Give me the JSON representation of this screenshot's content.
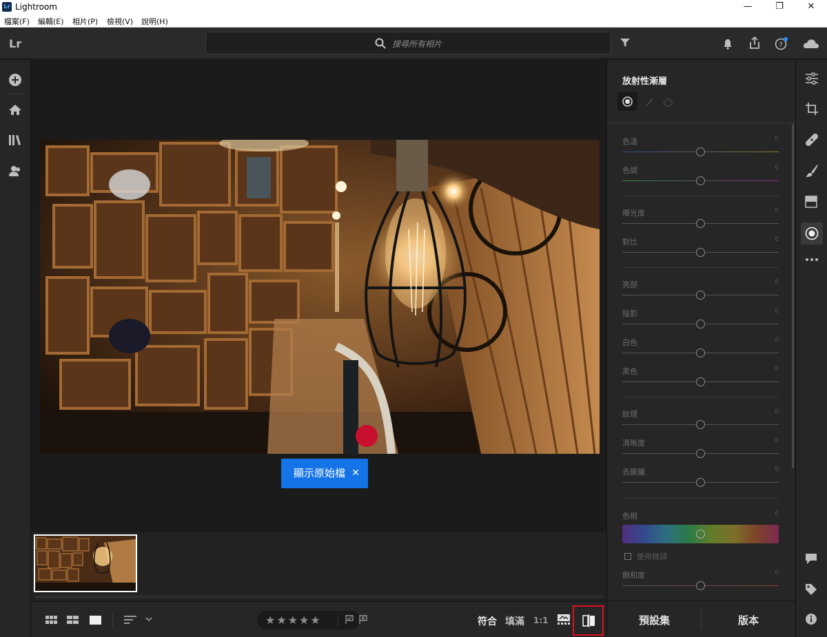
{
  "window": {
    "logo_text": "Lr",
    "title": "Lightroom",
    "minimize": "—",
    "maximize": "❐",
    "close": "✕"
  },
  "menu": [
    "檔案(F)",
    "編輯(E)",
    "相片(P)",
    "檢視(V)",
    "說明(H)"
  ],
  "topbar": {
    "logo": "Lr",
    "search_placeholder": "搜尋所有相片"
  },
  "canvas": {
    "show_original_label": "顯示原始檔",
    "show_original_close": "✕"
  },
  "bottombar": {
    "stars": "★★★★★",
    "fit": "符合",
    "fill": "填滿",
    "one_to_one": "1:1"
  },
  "panel": {
    "title": "放射性漸層",
    "sliders": [
      {
        "label": "色溫",
        "value": "0"
      },
      {
        "label": "色調",
        "value": "0"
      },
      {
        "label": "曝光度",
        "value": "0"
      },
      {
        "label": "對比",
        "value": "0"
      },
      {
        "label": "亮部",
        "value": "0"
      },
      {
        "label": "陰影",
        "value": "0"
      },
      {
        "label": "白色",
        "value": "0"
      },
      {
        "label": "黑色",
        "value": "0"
      },
      {
        "label": "紋理",
        "value": "0"
      },
      {
        "label": "清晰度",
        "value": "0"
      },
      {
        "label": "去朦朧",
        "value": "0"
      },
      {
        "label": "色相",
        "value": "0"
      },
      {
        "label": "飽和度",
        "value": "0"
      }
    ],
    "use_fine_adjust": "使用微調",
    "presets": "預設集",
    "versions": "版本"
  },
  "colors": {
    "accent": "#1473e6",
    "highlight": "#e0101c",
    "notification_dot": "#2d8ceb"
  }
}
